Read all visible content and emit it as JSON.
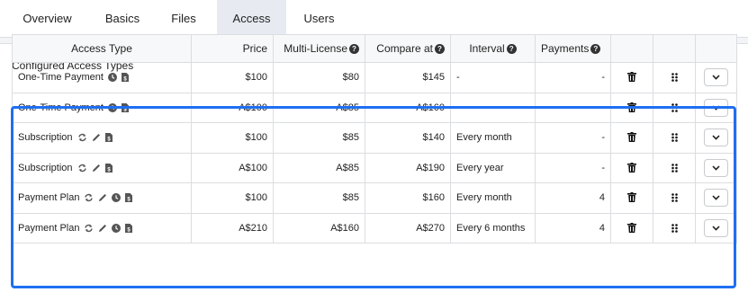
{
  "tabs": [
    {
      "label": "Overview"
    },
    {
      "label": "Basics"
    },
    {
      "label": "Files"
    },
    {
      "label": "Access"
    },
    {
      "label": "Users"
    }
  ],
  "active_tab": "Access",
  "section_title": "Configured Access Types",
  "columns": {
    "access_type": "Access Type",
    "price": "Price",
    "multi_license": "Multi-License",
    "compare_at": "Compare at",
    "interval": "Interval",
    "payments": "Payments"
  },
  "rows": [
    {
      "type": "One-Time Payment",
      "icons": [
        "clock-icon",
        "price-tag-icon"
      ],
      "price": "$100",
      "multi": "$80",
      "compare": "$145",
      "interval": "-",
      "payments": "-"
    },
    {
      "type": "One-Time Payment",
      "icons": [
        "clock-icon",
        "price-tag-icon"
      ],
      "price": "A$100",
      "multi": "A$85",
      "compare": "A$160",
      "interval": "-",
      "payments": "-"
    },
    {
      "type": "Subscription",
      "icons": [
        "recurring-icon",
        "pencil-icon",
        "price-tag-icon"
      ],
      "price": "$100",
      "multi": "$85",
      "compare": "$140",
      "interval": "Every month",
      "payments": "-"
    },
    {
      "type": "Subscription",
      "icons": [
        "recurring-icon",
        "pencil-icon",
        "price-tag-icon"
      ],
      "price": "A$100",
      "multi": "A$85",
      "compare": "A$190",
      "interval": "Every year",
      "payments": "-"
    },
    {
      "type": "Payment Plan",
      "icons": [
        "recurring-icon",
        "pencil-icon",
        "clock-icon",
        "price-tag-icon"
      ],
      "price": "$100",
      "multi": "$85",
      "compare": "$160",
      "interval": "Every month",
      "payments": "4"
    },
    {
      "type": "Payment Plan",
      "icons": [
        "recurring-icon",
        "pencil-icon",
        "clock-icon",
        "price-tag-icon"
      ],
      "price": "A$210",
      "multi": "A$160",
      "compare": "A$270",
      "interval": "Every 6 months",
      "payments": "4"
    }
  ],
  "colors": {
    "accent": "#2f6fd6",
    "highlight": "#1e6ff2",
    "icon": "#555555"
  }
}
